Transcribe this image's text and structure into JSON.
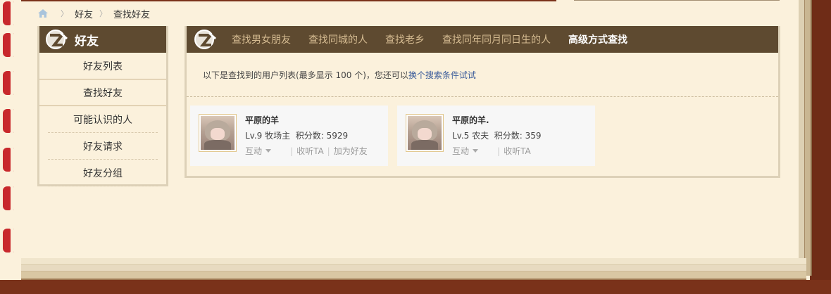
{
  "breadcrumb": {
    "home_icon": "home-icon",
    "items": [
      "好友",
      "查找好友"
    ]
  },
  "sidebar": {
    "title": "好友",
    "items": [
      {
        "label": "好友列表"
      },
      {
        "label": "查找好友"
      },
      {
        "label": "可能认识的人"
      },
      {
        "label": "好友请求"
      },
      {
        "label": "好友分组"
      }
    ]
  },
  "tabs": [
    {
      "label": "查找男女朋友"
    },
    {
      "label": "查找同城的人"
    },
    {
      "label": "查找老乡"
    },
    {
      "label": "查找同年同月同日生的人"
    },
    {
      "label": "高级方式查找"
    }
  ],
  "info": {
    "text": "以下是查找到的用户列表(最多显示 100 个)，您还可以",
    "link": "换个搜索条件试试"
  },
  "users": [
    {
      "name": "平原的羊",
      "level": "Lv.9 牧场主",
      "points_label": "积分数:",
      "points": "5929",
      "interact": "互动",
      "follow": "收听TA",
      "add_friend": "加为好友"
    },
    {
      "name": "平原的羊.",
      "level": "Lv.5 农夫",
      "points_label": "积分数:",
      "points": "359",
      "interact": "互动",
      "follow": "收听TA"
    }
  ],
  "colors": {
    "header": "#5e4a30",
    "tab_inactive": "#d6bc92",
    "background": "#fbf1dc",
    "link": "#3a5b9a"
  }
}
